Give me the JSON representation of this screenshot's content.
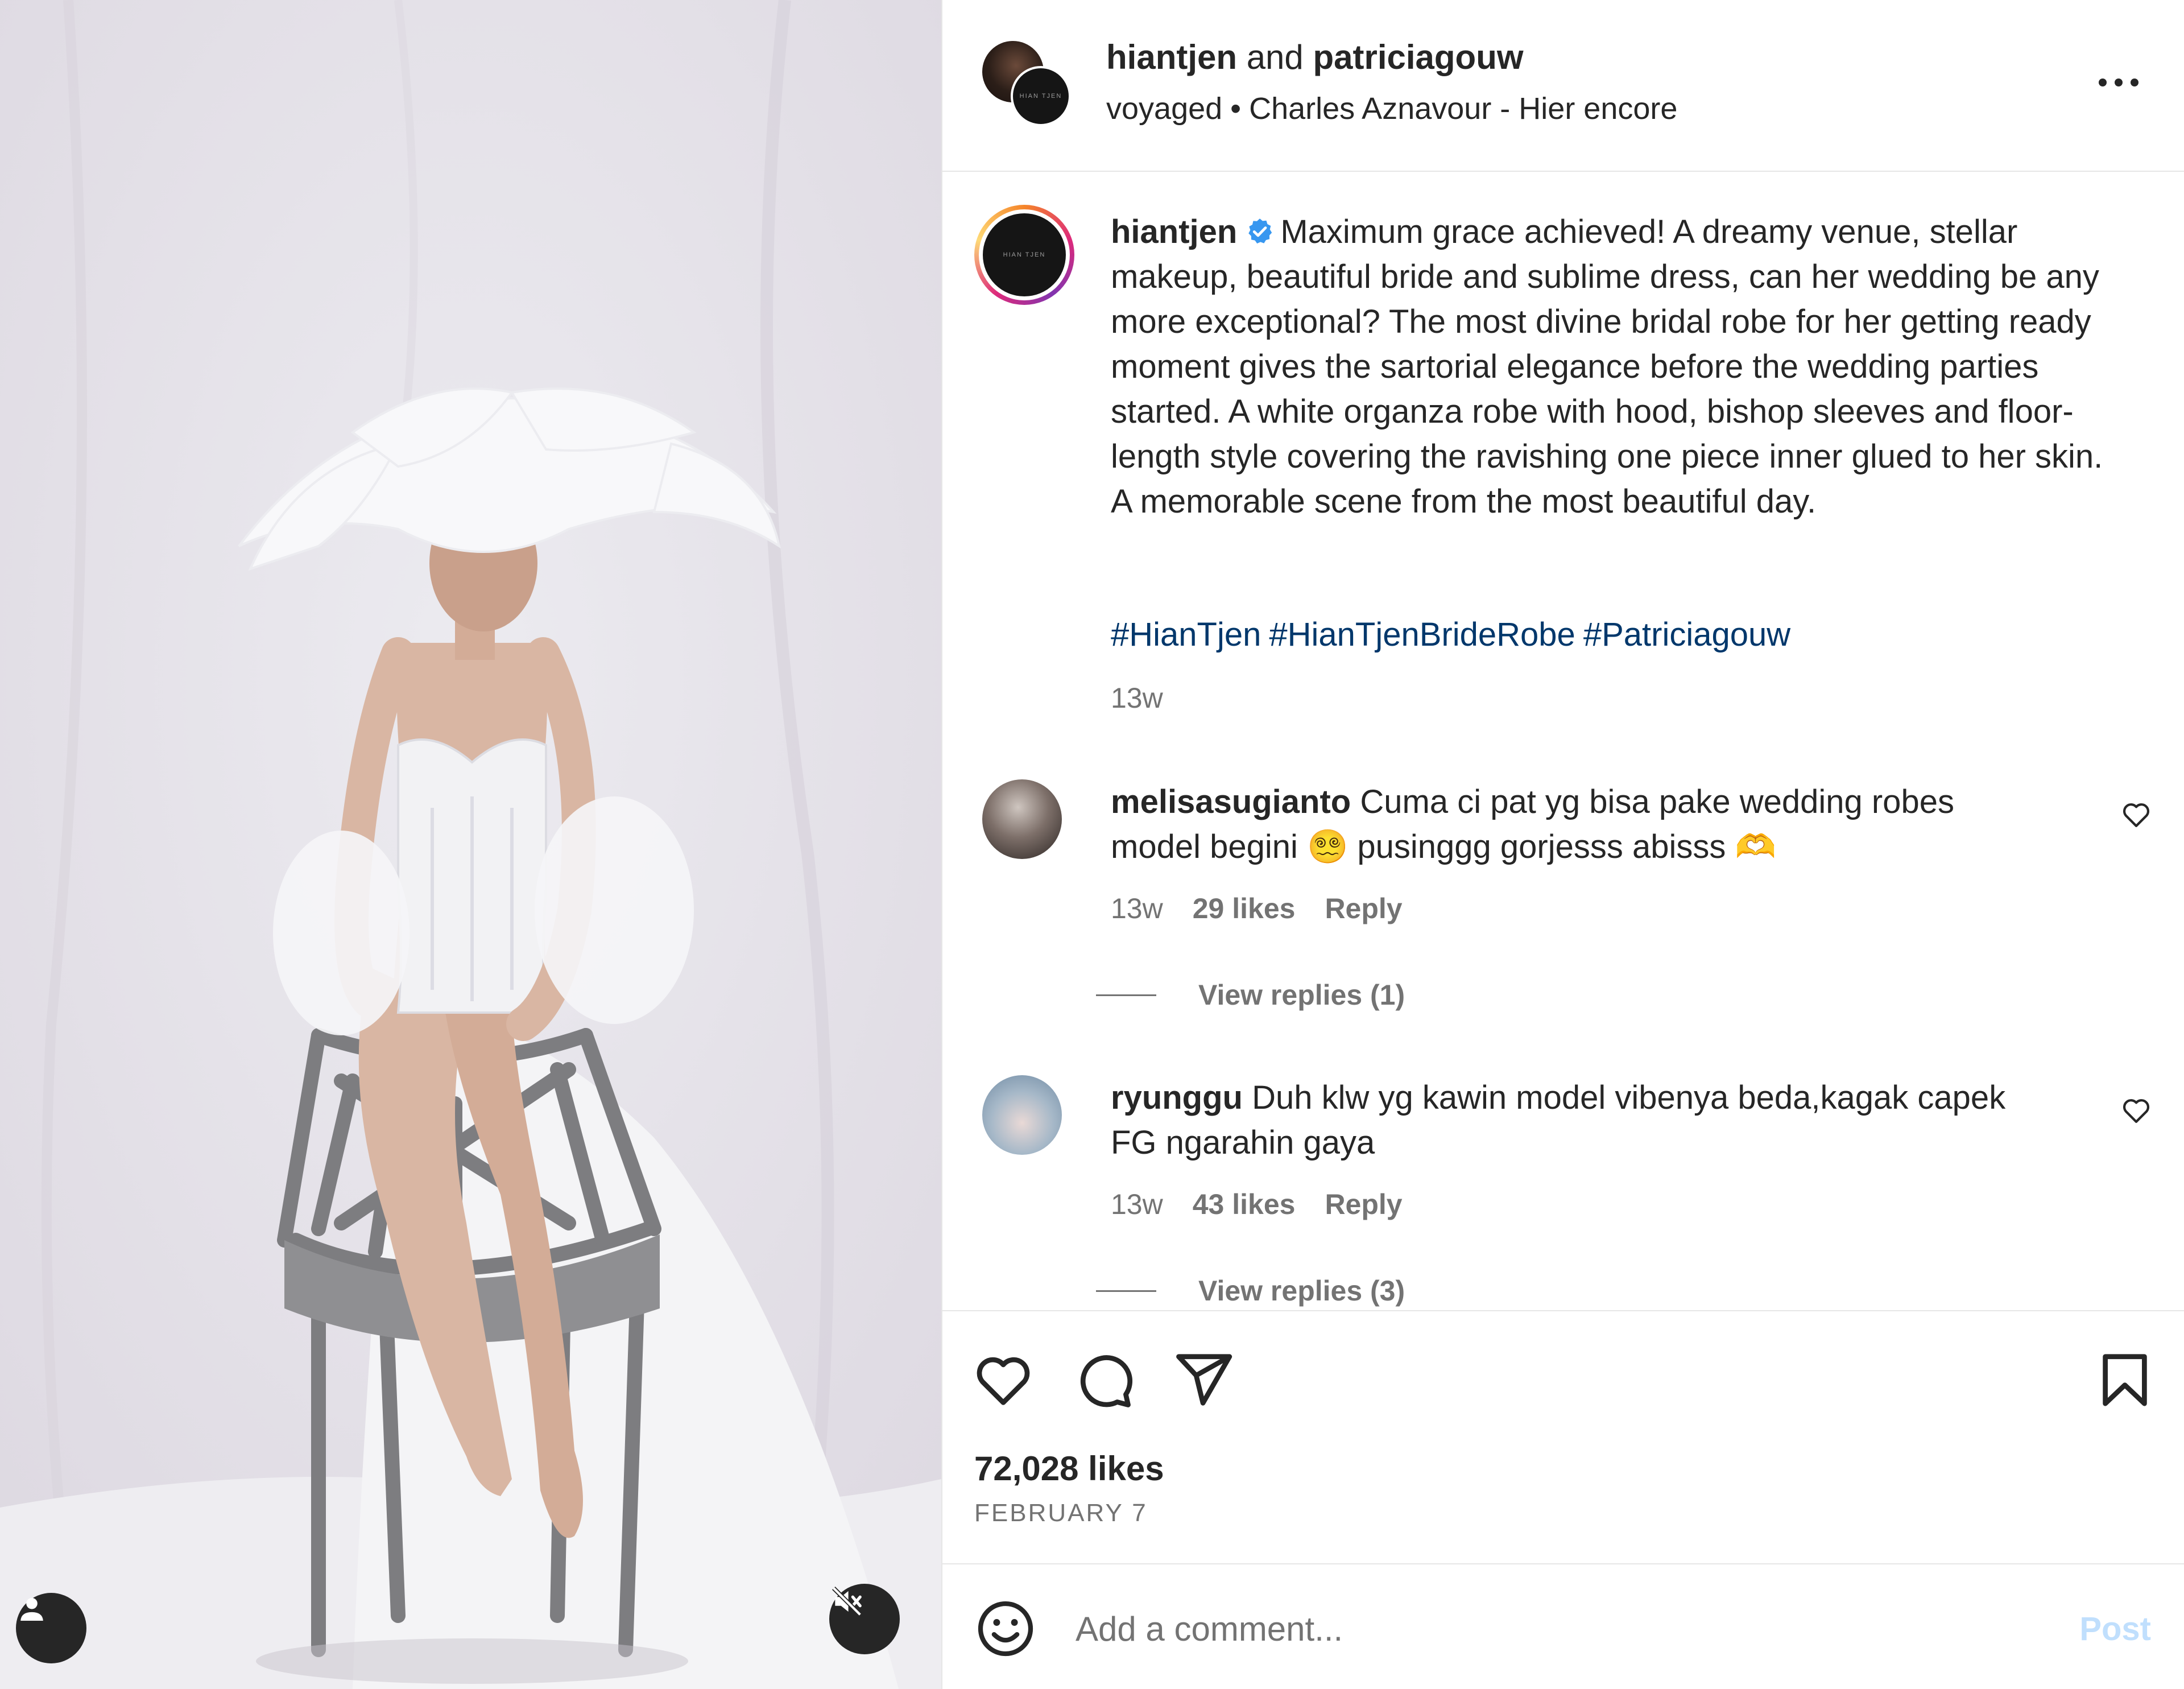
{
  "header": {
    "user1": "hiantjen",
    "and_text": "and",
    "user2": "patriciagouw",
    "audio_artist": "voyaged",
    "separator": "•",
    "audio_track": "Charles Aznavour - Hier encore",
    "more_icon": "more-horizontal-icon"
  },
  "caption": {
    "username": "hiantjen",
    "verified_icon": "verified-badge-icon",
    "text": "Maximum grace achieved! A dreamy venue, stellar makeup, beautiful bride and sublime dress, can her wedding be any more exceptional? The most divine bridal robe for her getting ready moment gives the sartorial elegance before the wedding parties started. A white organza robe with hood, bishop sleeves and floor-length style covering the ravishing one piece inner glued to her skin. A memorable scene from the most beautiful day.",
    "hashtags": [
      "#HianTjen",
      "#HianTjenBrideRobe",
      "#Patriciagouw"
    ],
    "time": "13w",
    "avatar_text": "HIAN TJEN"
  },
  "comments": [
    {
      "username": "melisasugianto",
      "text": "Cuma ci pat yg bisa pake wedding robes model begini 😵‍💫 pusinggg gorjesss abisss 🫶",
      "time": "13w",
      "likes": "29 likes",
      "reply": "Reply",
      "view_replies": "View replies (1)"
    },
    {
      "username": "ryunggu",
      "text": "Duh klw yg kawin model vibenya beda,kagak capek FG ngarahin gaya",
      "time": "13w",
      "likes": "43 likes",
      "reply": "Reply",
      "view_replies": "View replies (3)"
    }
  ],
  "actions": {
    "like_icon": "heart-icon",
    "comment_icon": "comment-bubble-icon",
    "share_icon": "paper-plane-icon",
    "save_icon": "bookmark-icon",
    "likes_count": "72,028 likes",
    "date": "FEBRUARY 7"
  },
  "comment_bar": {
    "emoji_icon": "smiley-icon",
    "placeholder": "Add a comment...",
    "post_label": "Post"
  },
  "media": {
    "user_tag_icon": "person-icon",
    "mute_icon": "speaker-muted-icon"
  }
}
